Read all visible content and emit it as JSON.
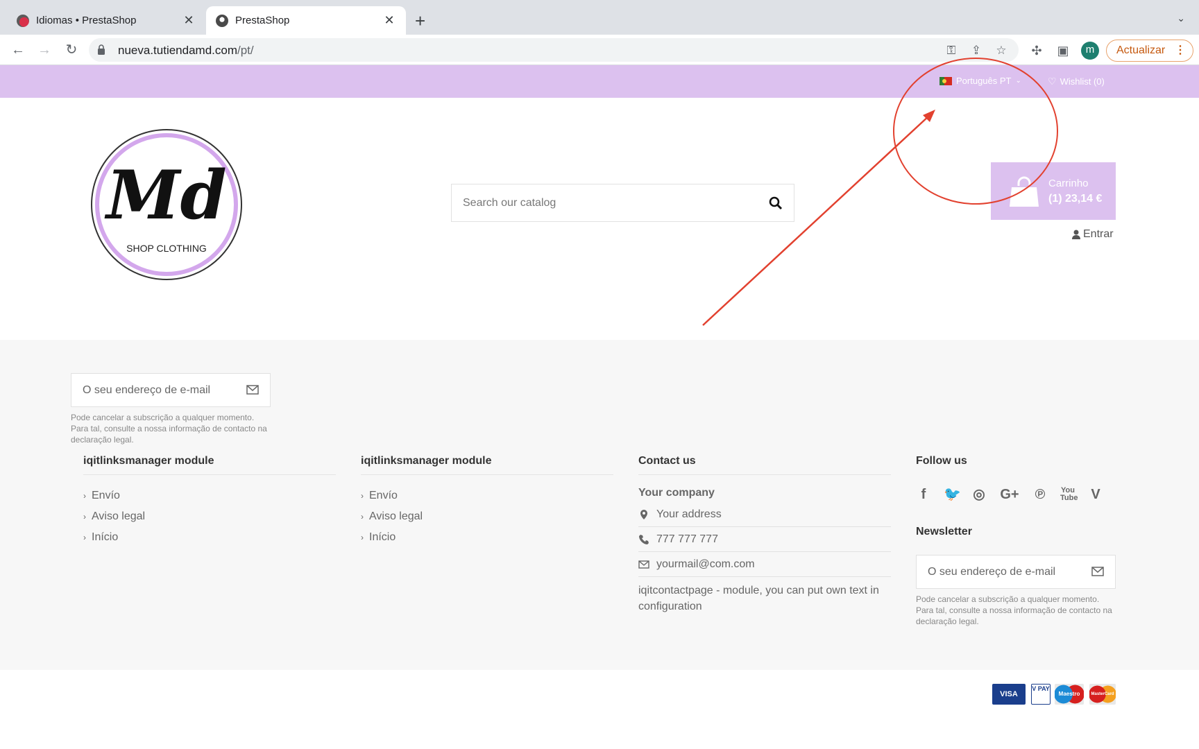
{
  "browser": {
    "tabs": [
      {
        "title": "Idiomas • PrestaShop",
        "active": false
      },
      {
        "title": "PrestaShop",
        "active": true
      }
    ],
    "url_host": "nueva.tutiendamd.com",
    "url_path": "/pt/",
    "profile_initial": "m",
    "update_label": "Actualizar"
  },
  "topbar": {
    "language": "Português PT",
    "wishlist": "Wishlist (0)"
  },
  "header": {
    "logo_text": "Md",
    "logo_subtext": "SHOP CLOTHING",
    "search_placeholder": "Search our catalog",
    "cart_title": "Carrinho",
    "cart_total": "(1) 23,14 €",
    "login_label": "Entrar"
  },
  "footer": {
    "newsletter_placeholder": "O seu endereço de e-mail",
    "newsletter_note": "Pode cancelar a subscrição a qualquer momento. Para tal, consulte a nossa informação de contacto na declaração legal.",
    "columns": [
      {
        "title": "iqitlinksmanager module",
        "links": [
          "Envío",
          "Aviso legal",
          "Início"
        ]
      },
      {
        "title": "iqitlinksmanager module",
        "links": [
          "Envío",
          "Aviso legal",
          "Início"
        ]
      }
    ],
    "contact": {
      "title": "Contact us",
      "company": "Your company",
      "address": "Your address",
      "phone": "777 777 777",
      "email": "yourmail@com.com",
      "note": "iqitcontactpage - module, you can put own text in configuration"
    },
    "follow_title": "Follow us",
    "social_icons": [
      "facebook-icon",
      "twitter-icon",
      "instagram-icon",
      "google-plus-icon",
      "pinterest-icon",
      "youtube-icon",
      "vimeo-icon"
    ],
    "newsletter_title": "Newsletter"
  },
  "payments": [
    "VISA",
    "V PAY",
    "Maestro",
    "MasterCard"
  ],
  "colors": {
    "accent": "#dcc1ef",
    "annotation": "#e2412f"
  }
}
